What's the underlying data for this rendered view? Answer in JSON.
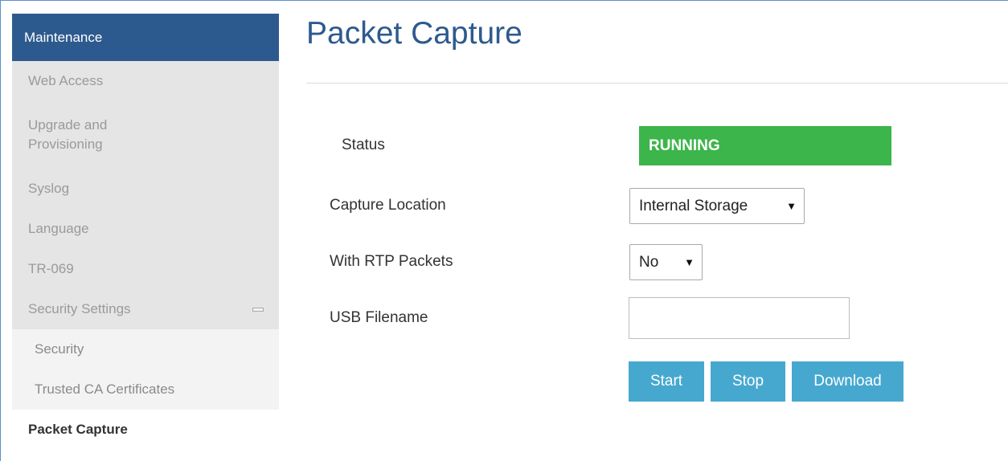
{
  "sidebar": {
    "header": "Maintenance",
    "items": [
      {
        "label": "Web Access"
      },
      {
        "label": "Upgrade and Provisioning"
      },
      {
        "label": "Syslog"
      },
      {
        "label": "Language"
      },
      {
        "label": "TR-069"
      },
      {
        "label": "Security Settings"
      }
    ],
    "subitems": [
      {
        "label": "Security"
      },
      {
        "label": "Trusted CA Certificates"
      }
    ],
    "active": "Packet Capture"
  },
  "main": {
    "title": "Packet Capture",
    "status": {
      "label": "Status",
      "value": "RUNNING",
      "color": "#3cb54a"
    },
    "capture_location": {
      "label": "Capture Location",
      "value": "Internal Storage"
    },
    "rtp_packets": {
      "label": "With RTP Packets",
      "value": "No"
    },
    "usb_filename": {
      "label": "USB Filename",
      "value": ""
    },
    "buttons": {
      "start": "Start",
      "stop": "Stop",
      "download": "Download"
    }
  },
  "colors": {
    "header_bg": "#2d5a8e",
    "button_bg": "#46a8cf",
    "status_bg": "#3cb54a",
    "sidebar_bg": "#e5e5e5"
  }
}
